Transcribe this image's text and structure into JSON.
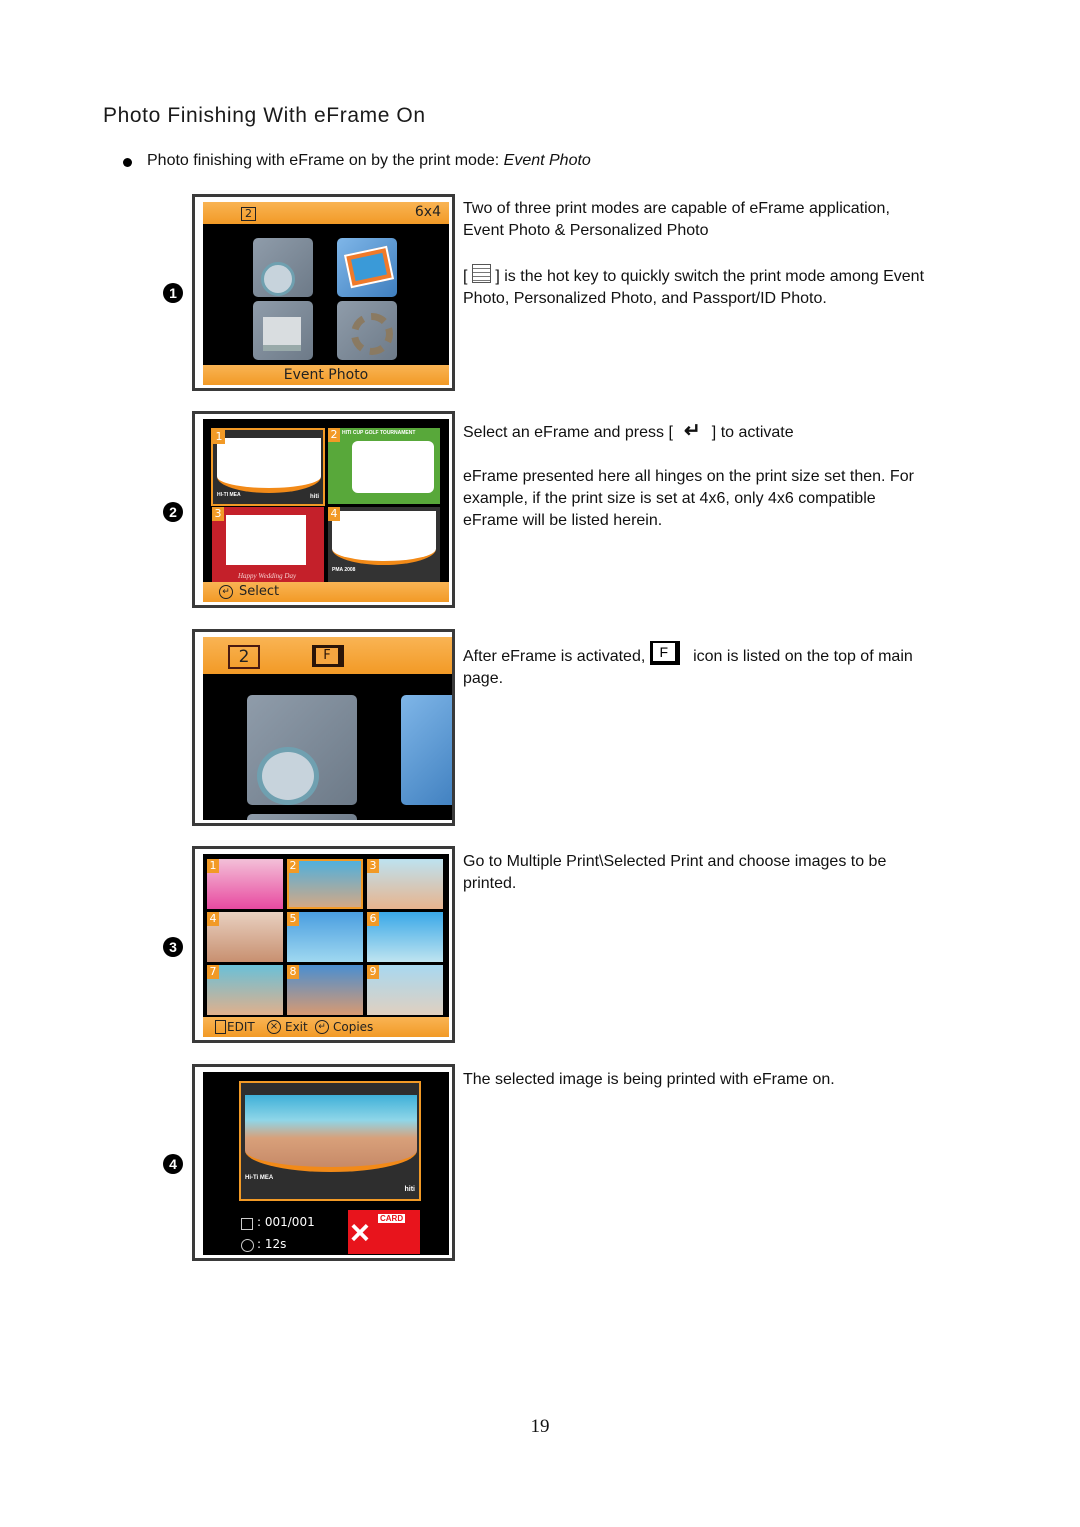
{
  "title": "Photo Finishing With eFrame On",
  "bullet": {
    "text": "Photo finishing with eFrame on by the print mode: ",
    "mode": "Event Photo"
  },
  "steps": [
    {
      "number": "1",
      "screen": {
        "badge": "2",
        "size": "6x4",
        "footer": "Event Photo",
        "tiles": [
          "event-photo",
          "personalized-photo",
          "passport-id",
          "settings"
        ]
      },
      "desc": {
        "p1": "Two of three print modes are capable of eFrame application, Event Photo & Personalized Photo",
        "p2_open": "[",
        "p2_icon": "hot-key-icon",
        "p2_rest": "] is the hot key to quickly switch the print mode among Event Photo, Personalized Photo, and Passport/ID Photo."
      }
    },
    {
      "number": "2",
      "screen": {
        "frames": [
          "1",
          "2",
          "3",
          "4"
        ],
        "frame2_title": "HITI CUP GOLF TOURNAMENT",
        "frame1_label": "HI-TI MEA",
        "frame4_label": "PMA 2008",
        "frame3_label": "Happy Wedding Day",
        "brand": "hiti",
        "footer": "Select"
      },
      "desc": {
        "p1_before": "Select an eFrame and press [",
        "p1_after": "] to activate",
        "p2": "eFrame presented here all hinges on the print size set then.   For example, if the print size is set at 4x6, only 4x6 compatible eFrame will be listed herein."
      }
    },
    {
      "number": "",
      "screen": {
        "badge": "2",
        "eframe_icon": "F"
      },
      "desc": {
        "p1_before": "After eFrame is activated,",
        "icon_letter": "F",
        "p1_after": "icon is listed on the top of main page."
      }
    },
    {
      "number": "3",
      "screen": {
        "photos": [
          "1",
          "2",
          "3",
          "4",
          "5",
          "6",
          "7",
          "8",
          "9"
        ],
        "selected": "2",
        "footer": {
          "edit": "EDIT",
          "exit": "Exit",
          "copies": "Copies"
        }
      },
      "desc": {
        "p1": "Go to Multiple Print\\Selected Print and choose images to be printed."
      }
    },
    {
      "number": "4",
      "screen": {
        "frame_label": "Hi-Ti MEA",
        "brand": "hiti",
        "count": ": 001/001",
        "time": ": 12s",
        "card_label": "CARD"
      },
      "desc": {
        "p1": "The selected image is being printed with eFrame on."
      }
    }
  ],
  "page_number": "19",
  "colors": {
    "orange": "#f29a26",
    "screen_bg": "#000000",
    "card_red": "#e8141c"
  }
}
